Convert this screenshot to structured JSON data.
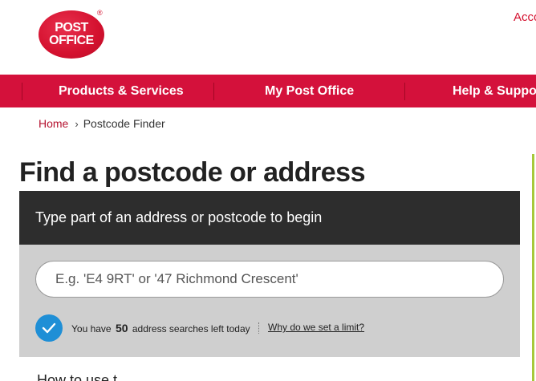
{
  "header": {
    "logo_line1": "POST",
    "logo_line2": "OFFICE",
    "logo_mark": "®",
    "account_link": "Acco"
  },
  "nav": {
    "items": [
      {
        "label": "Products & Services"
      },
      {
        "label": "My Post Office"
      },
      {
        "label": "Help & Suppo"
      }
    ]
  },
  "breadcrumb": {
    "home": "Home",
    "separator": "›",
    "current": "Postcode Finder"
  },
  "page": {
    "title": "Find a postcode or address"
  },
  "search": {
    "instruction": "Type part of an address or postcode to begin",
    "placeholder": "E.g. 'E4 9RT' or '47 Richmond Crescent'",
    "value": "",
    "limit_prefix": "You have",
    "limit_count": "50",
    "limit_suffix": "address searches left today",
    "limit_link": "Why do we set a limit?"
  },
  "below": {
    "cut_off_text": "How to use t"
  },
  "colors": {
    "brand_red": "#d4113b",
    "dark_band": "#2d2d2d",
    "panel_grey": "#cfcfcf",
    "check_blue": "#1f8fd6",
    "accent_green": "#a6c93a"
  }
}
